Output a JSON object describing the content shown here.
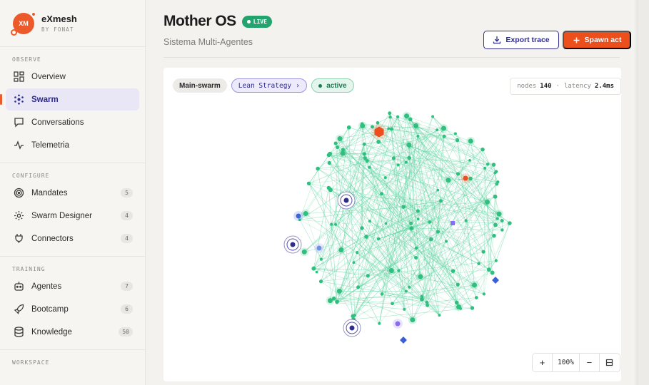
{
  "brand": {
    "logo_text": "XM",
    "name": "eXmesh",
    "sub": "BY FONAT"
  },
  "sidebar": {
    "sections": [
      {
        "title": "OBSERVE",
        "items": [
          {
            "label": "Overview",
            "icon": "grid-icon"
          },
          {
            "label": "Swarm",
            "icon": "hexagon-nodes-icon",
            "active": true
          },
          {
            "label": "Conversations",
            "icon": "chat-bubble-icon"
          },
          {
            "label": "Telemetria",
            "icon": "pulse-icon"
          }
        ]
      },
      {
        "title": "CONFIGURE",
        "items": [
          {
            "label": "Mandates",
            "icon": "target-icon",
            "count": "5"
          },
          {
            "label": "Swarm Designer",
            "icon": "cog-icon",
            "count": "4"
          },
          {
            "label": "Connectors",
            "icon": "plug-icon",
            "count": "4"
          }
        ]
      },
      {
        "title": "TRAINING",
        "items": [
          {
            "label": "Agentes",
            "icon": "robot-icon",
            "count": "7"
          },
          {
            "label": "Bootcamp",
            "icon": "rocket-icon",
            "count": "6"
          },
          {
            "label": "Knowledge",
            "icon": "database-icon",
            "count": "50"
          }
        ]
      },
      {
        "title": "WORKSPACE",
        "items": []
      }
    ]
  },
  "header": {
    "title": "Mother OS",
    "status": "LIVE",
    "subtitle": "Sistema Multi-Agentes",
    "export_label": "Export trace",
    "spawn_label": "Spawn act"
  },
  "canvas": {
    "swarm_chip": "Main-swarm",
    "strategy_chip": "Lean Strategy",
    "status_chip": "active",
    "stats": {
      "nodes_label": "nodes",
      "nodes_value": "140",
      "latency_label": "latency",
      "latency_value": "2.4ms"
    },
    "zoom": {
      "in": "+",
      "value": "100%",
      "out": "−"
    }
  },
  "colors": {
    "accent_orange": "#ec4e1c",
    "brand_indigo": "#2f2c8c",
    "node_green": "#2fbf7e",
    "edge_green": "#5fd3a0",
    "live_green": "#24a36e"
  }
}
